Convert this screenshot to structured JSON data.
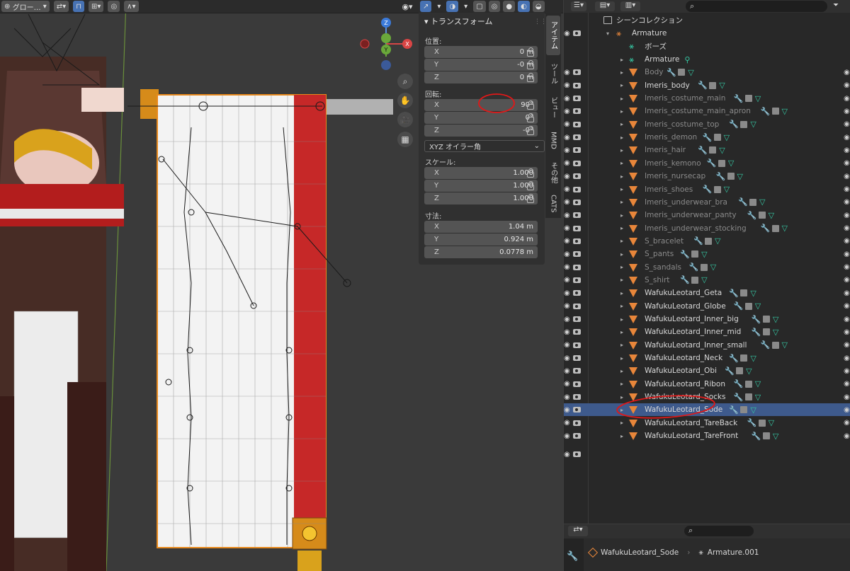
{
  "viewport": {
    "header": {
      "mode_label": "グロー…"
    },
    "transform_panel": {
      "title": "トランスフォーム",
      "location": {
        "label": "位置:",
        "x": "0 m",
        "y": "-0 m",
        "z": "0 m"
      },
      "rotation": {
        "label": "回転:",
        "x": "90°",
        "y": "0°",
        "z": "-0°",
        "mode": "XYZ オイラー角"
      },
      "scale": {
        "label": "スケール:",
        "x": "1.000",
        "y": "1.000",
        "z": "1.000"
      },
      "dimensions": {
        "label": "寸法:",
        "x": "1.04 m",
        "y": "0.924 m",
        "z": "0.0778 m"
      },
      "axis_labels": {
        "x": "X",
        "y": "Y",
        "z": "Z"
      }
    },
    "sidebar_tabs": [
      "アイテム",
      "ツール",
      "ビュー",
      "MMD",
      "その他",
      "CATS"
    ],
    "gizmo": {
      "x": "X",
      "y": "Y",
      "z": "Z"
    }
  },
  "outliner": {
    "scene_collection": "シーンコレクション",
    "armature_root": "Armature",
    "pose": "ボーズ",
    "items": [
      {
        "name": "Armature",
        "dim": false,
        "type": "armature"
      },
      {
        "name": "Body",
        "dim": true
      },
      {
        "name": "Imeris_body",
        "dim": false
      },
      {
        "name": "Imeris_costume_main",
        "dim": true
      },
      {
        "name": "Imeris_costume_main_apron",
        "dim": true
      },
      {
        "name": "Imeris_costume_top",
        "dim": true
      },
      {
        "name": "Imeris_demon",
        "dim": true
      },
      {
        "name": "Imeris_hair",
        "dim": true
      },
      {
        "name": "Imeris_kemono",
        "dim": true
      },
      {
        "name": "Imeris_nursecap",
        "dim": true
      },
      {
        "name": "Imeris_shoes",
        "dim": true
      },
      {
        "name": "Imeris_underwear_bra",
        "dim": true
      },
      {
        "name": "Imeris_underwear_panty",
        "dim": true
      },
      {
        "name": "Imeris_underwear_stocking",
        "dim": true
      },
      {
        "name": "S_bracelet",
        "dim": true
      },
      {
        "name": "S_pants",
        "dim": true
      },
      {
        "name": "S_sandals",
        "dim": true
      },
      {
        "name": "S_shirt",
        "dim": true
      },
      {
        "name": "WafukuLeotard_Geta",
        "dim": false
      },
      {
        "name": "WafukuLeotard_Globe",
        "dim": false
      },
      {
        "name": "WafukuLeotard_Inner_big",
        "dim": false
      },
      {
        "name": "WafukuLeotard_Inner_mid",
        "dim": false
      },
      {
        "name": "WafukuLeotard_Inner_small",
        "dim": false
      },
      {
        "name": "WafukuLeotard_Neck",
        "dim": false
      },
      {
        "name": "WafukuLeotard_Obi",
        "dim": false
      },
      {
        "name": "WafukuLeotard_Ribon",
        "dim": false
      },
      {
        "name": "WafukuLeotard_Socks",
        "dim": false
      },
      {
        "name": "WafukuLeotard_Sode",
        "dim": false,
        "selected": true
      },
      {
        "name": "WafukuLeotard_TareBack",
        "dim": false
      },
      {
        "name": "WafukuLeotard_TareFront",
        "dim": false
      }
    ]
  },
  "properties": {
    "object_name": "WafukuLeotard_Sode",
    "armature_name": "Armature.001"
  },
  "colors": {
    "accent": "#4772b3",
    "selection": "#3e5a8c",
    "annotation": "#e01818",
    "mesh_icon": "#e8863a",
    "vertex_group": "#36c8a4",
    "modifier": "#5b8bd1"
  }
}
